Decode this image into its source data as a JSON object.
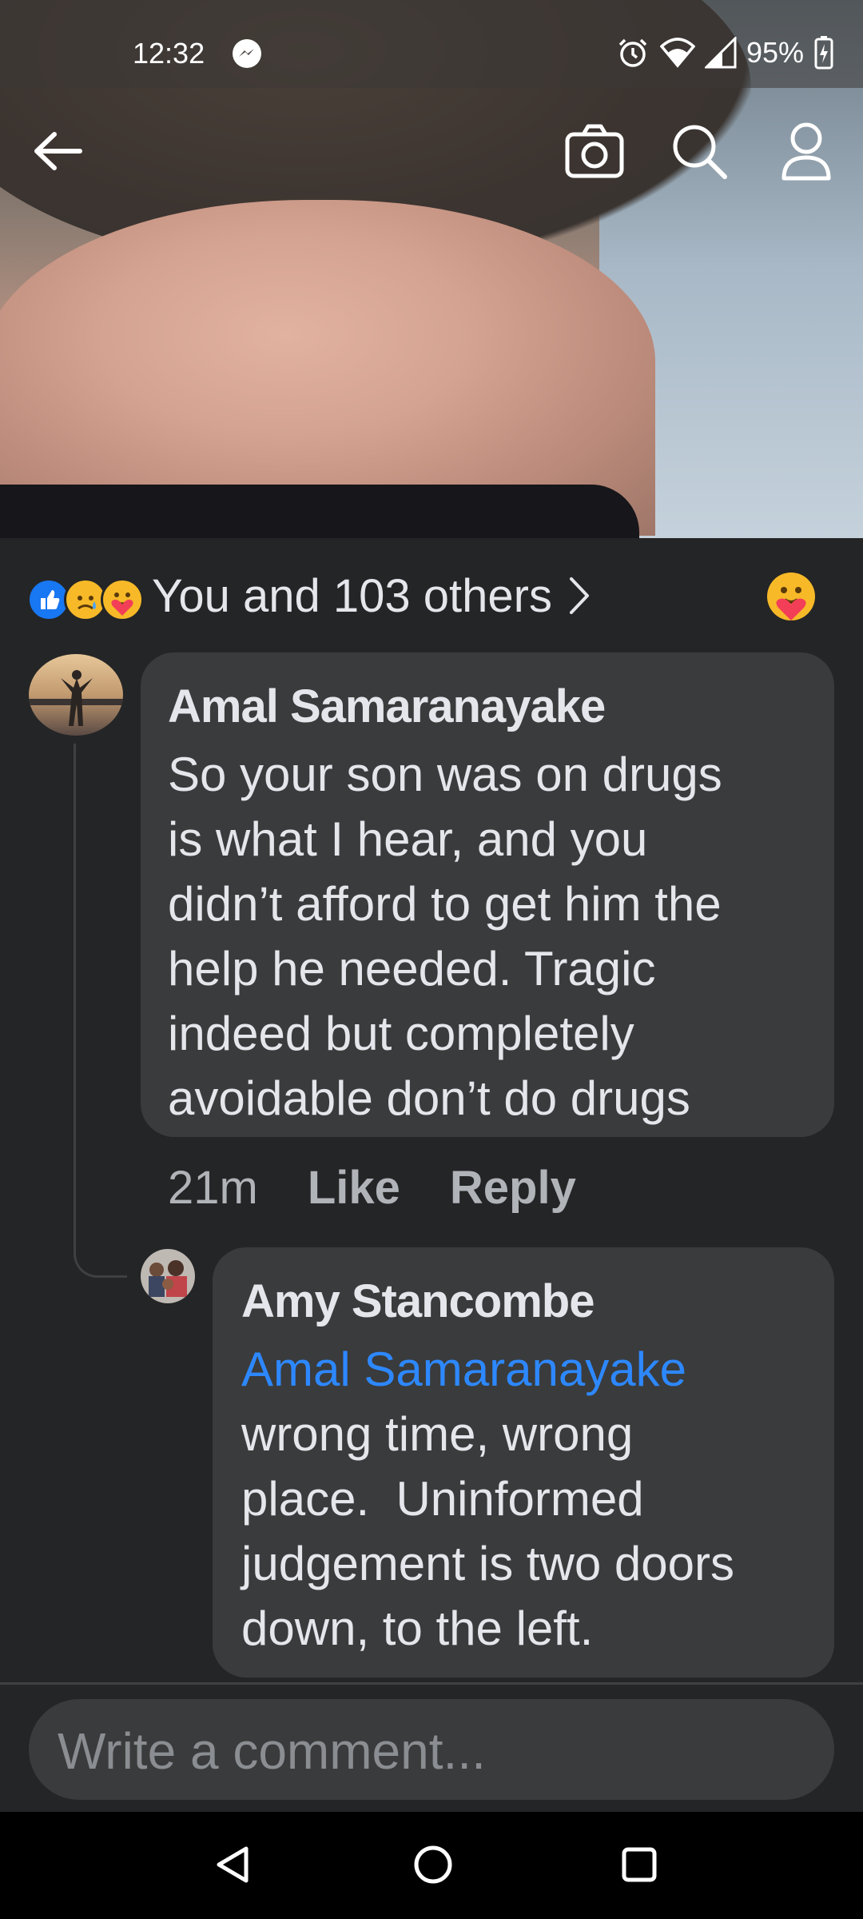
{
  "status_bar": {
    "time": "12:32",
    "battery": "95%"
  },
  "header": {
    "back": "back",
    "camera": "camera",
    "search": "search",
    "profile": "profile"
  },
  "reactions": {
    "summary": "You and 103 others"
  },
  "comments": [
    {
      "author": "Amal Samaranayake",
      "lines": [
        "So your son was on drugs",
        "is what I hear, and you",
        "didn’t afford to get him the",
        "help he needed. Tragic",
        "indeed but completely",
        "avoidable don’t do drugs"
      ],
      "time": "21m",
      "like_label": "Like",
      "reply_label": "Reply"
    },
    {
      "author": "Amy Stancombe",
      "mention": "Amal Samaranayake",
      "lines": [
        "wrong time, wrong",
        "place.  Uninformed",
        "judgement is two doors",
        "down, to the left."
      ]
    }
  ],
  "composer": {
    "placeholder": "Write a comment..."
  },
  "colors": {
    "background": "#242526",
    "bubble": "#3a3b3c",
    "mention": "#2d88ff",
    "like": "#1877f2"
  }
}
